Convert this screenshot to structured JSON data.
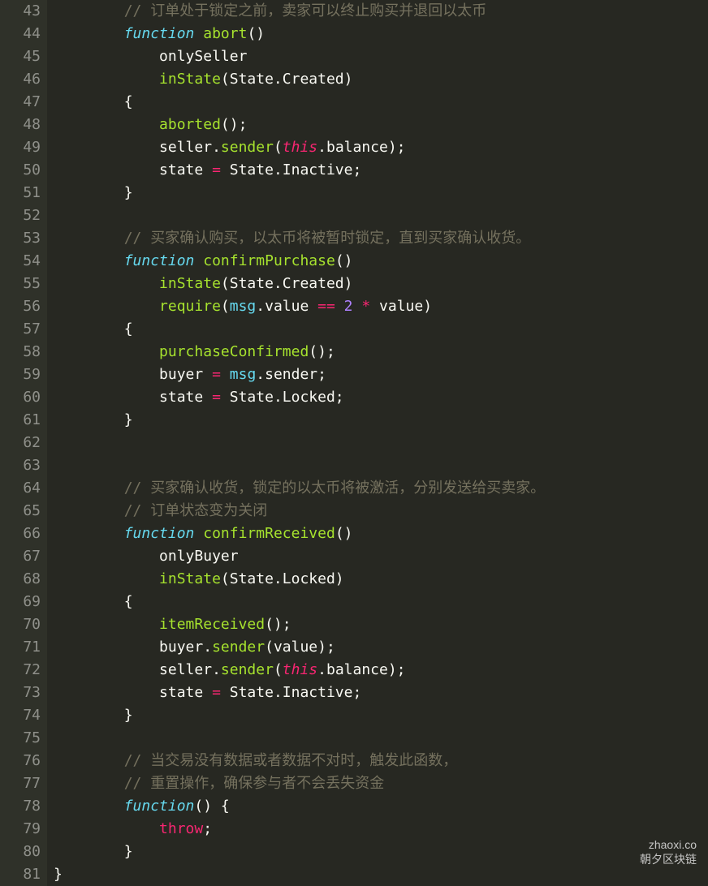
{
  "watermark": {
    "url": "zhaoxi.co",
    "text": "朝夕区块链"
  },
  "startLine": 43,
  "lines": [
    {
      "n": 43,
      "indent": 2,
      "t": [
        {
          "c": "tok-comment",
          "s": "// 订单处于锁定之前，卖家可以终止购买并退回以太币"
        }
      ]
    },
    {
      "n": 44,
      "indent": 2,
      "t": [
        {
          "c": "tok-keyword",
          "s": "function"
        },
        {
          "c": "tok-punct",
          "s": " "
        },
        {
          "c": "tok-funcname",
          "s": "abort"
        },
        {
          "c": "tok-punct",
          "s": "()"
        }
      ]
    },
    {
      "n": 45,
      "indent": 3,
      "t": [
        {
          "c": "tok-ident",
          "s": "onlySeller"
        }
      ]
    },
    {
      "n": 46,
      "indent": 3,
      "t": [
        {
          "c": "tok-funcname",
          "s": "inState"
        },
        {
          "c": "tok-punct",
          "s": "(State.Created)"
        }
      ]
    },
    {
      "n": 47,
      "indent": 2,
      "t": [
        {
          "c": "tok-punct",
          "s": "{"
        }
      ]
    },
    {
      "n": 48,
      "indent": 3,
      "t": [
        {
          "c": "tok-funcname",
          "s": "aborted"
        },
        {
          "c": "tok-punct",
          "s": "();"
        }
      ]
    },
    {
      "n": 49,
      "indent": 3,
      "t": [
        {
          "c": "tok-ident",
          "s": "seller."
        },
        {
          "c": "tok-funcname",
          "s": "sender"
        },
        {
          "c": "tok-punct",
          "s": "("
        },
        {
          "c": "tok-this",
          "s": "this"
        },
        {
          "c": "tok-punct",
          "s": ".balance);"
        }
      ]
    },
    {
      "n": 50,
      "indent": 3,
      "t": [
        {
          "c": "tok-ident",
          "s": "state "
        },
        {
          "c": "tok-op",
          "s": "="
        },
        {
          "c": "tok-ident",
          "s": " State.Inactive;"
        }
      ]
    },
    {
      "n": 51,
      "indent": 2,
      "t": [
        {
          "c": "tok-punct",
          "s": "}"
        }
      ]
    },
    {
      "n": 52,
      "indent": 0,
      "t": []
    },
    {
      "n": 53,
      "indent": 2,
      "t": [
        {
          "c": "tok-comment",
          "s": "// 买家确认购买，以太币将被暂时锁定，直到买家确认收货。"
        }
      ]
    },
    {
      "n": 54,
      "indent": 2,
      "t": [
        {
          "c": "tok-keyword",
          "s": "function"
        },
        {
          "c": "tok-punct",
          "s": " "
        },
        {
          "c": "tok-funcname",
          "s": "confirmPurchase"
        },
        {
          "c": "tok-punct",
          "s": "()"
        }
      ]
    },
    {
      "n": 55,
      "indent": 3,
      "t": [
        {
          "c": "tok-funcname",
          "s": "inState"
        },
        {
          "c": "tok-punct",
          "s": "(State.Created)"
        }
      ]
    },
    {
      "n": 56,
      "indent": 3,
      "t": [
        {
          "c": "tok-funcname",
          "s": "require"
        },
        {
          "c": "tok-punct",
          "s": "("
        },
        {
          "c": "tok-var",
          "s": "msg"
        },
        {
          "c": "tok-punct",
          "s": ".value "
        },
        {
          "c": "tok-op",
          "s": "=="
        },
        {
          "c": "tok-punct",
          "s": " "
        },
        {
          "c": "tok-number",
          "s": "2"
        },
        {
          "c": "tok-punct",
          "s": " "
        },
        {
          "c": "tok-op",
          "s": "*"
        },
        {
          "c": "tok-punct",
          "s": " value)"
        }
      ]
    },
    {
      "n": 57,
      "indent": 2,
      "t": [
        {
          "c": "tok-punct",
          "s": "{"
        }
      ]
    },
    {
      "n": 58,
      "indent": 3,
      "t": [
        {
          "c": "tok-funcname",
          "s": "purchaseConfirmed"
        },
        {
          "c": "tok-punct",
          "s": "();"
        }
      ]
    },
    {
      "n": 59,
      "indent": 3,
      "t": [
        {
          "c": "tok-ident",
          "s": "buyer "
        },
        {
          "c": "tok-op",
          "s": "="
        },
        {
          "c": "tok-ident",
          "s": " "
        },
        {
          "c": "tok-var",
          "s": "msg"
        },
        {
          "c": "tok-punct",
          "s": ".sender;"
        }
      ]
    },
    {
      "n": 60,
      "indent": 3,
      "t": [
        {
          "c": "tok-ident",
          "s": "state "
        },
        {
          "c": "tok-op",
          "s": "="
        },
        {
          "c": "tok-ident",
          "s": " State.Locked;"
        }
      ]
    },
    {
      "n": 61,
      "indent": 2,
      "t": [
        {
          "c": "tok-punct",
          "s": "}"
        }
      ]
    },
    {
      "n": 62,
      "indent": 0,
      "t": []
    },
    {
      "n": 63,
      "indent": 0,
      "t": []
    },
    {
      "n": 64,
      "indent": 2,
      "t": [
        {
          "c": "tok-comment",
          "s": "// 买家确认收货，锁定的以太币将被激活，分别发送给买卖家。"
        }
      ]
    },
    {
      "n": 65,
      "indent": 2,
      "t": [
        {
          "c": "tok-comment",
          "s": "// 订单状态变为关闭"
        }
      ]
    },
    {
      "n": 66,
      "indent": 2,
      "t": [
        {
          "c": "tok-keyword",
          "s": "function"
        },
        {
          "c": "tok-punct",
          "s": " "
        },
        {
          "c": "tok-funcname",
          "s": "confirmReceived"
        },
        {
          "c": "tok-punct",
          "s": "()"
        }
      ]
    },
    {
      "n": 67,
      "indent": 3,
      "t": [
        {
          "c": "tok-ident",
          "s": "onlyBuyer"
        }
      ]
    },
    {
      "n": 68,
      "indent": 3,
      "t": [
        {
          "c": "tok-funcname",
          "s": "inState"
        },
        {
          "c": "tok-punct",
          "s": "(State.Locked)"
        }
      ]
    },
    {
      "n": 69,
      "indent": 2,
      "t": [
        {
          "c": "tok-punct",
          "s": "{"
        }
      ]
    },
    {
      "n": 70,
      "indent": 3,
      "t": [
        {
          "c": "tok-funcname",
          "s": "itemReceived"
        },
        {
          "c": "tok-punct",
          "s": "();"
        }
      ]
    },
    {
      "n": 71,
      "indent": 3,
      "t": [
        {
          "c": "tok-ident",
          "s": "buyer."
        },
        {
          "c": "tok-funcname",
          "s": "sender"
        },
        {
          "c": "tok-punct",
          "s": "(value);"
        }
      ]
    },
    {
      "n": 72,
      "indent": 3,
      "t": [
        {
          "c": "tok-ident",
          "s": "seller."
        },
        {
          "c": "tok-funcname",
          "s": "sender"
        },
        {
          "c": "tok-punct",
          "s": "("
        },
        {
          "c": "tok-this",
          "s": "this"
        },
        {
          "c": "tok-punct",
          "s": ".balance);"
        }
      ]
    },
    {
      "n": 73,
      "indent": 3,
      "t": [
        {
          "c": "tok-ident",
          "s": "state "
        },
        {
          "c": "tok-op",
          "s": "="
        },
        {
          "c": "tok-ident",
          "s": " State.Inactive;"
        }
      ]
    },
    {
      "n": 74,
      "indent": 2,
      "t": [
        {
          "c": "tok-punct",
          "s": "}"
        }
      ]
    },
    {
      "n": 75,
      "indent": 0,
      "t": []
    },
    {
      "n": 76,
      "indent": 2,
      "t": [
        {
          "c": "tok-comment",
          "s": "// 当交易没有数据或者数据不对时，触发此函数，"
        }
      ]
    },
    {
      "n": 77,
      "indent": 2,
      "t": [
        {
          "c": "tok-comment",
          "s": "// 重置操作，确保参与者不会丢失资金"
        }
      ]
    },
    {
      "n": 78,
      "indent": 2,
      "t": [
        {
          "c": "tok-keyword",
          "s": "function"
        },
        {
          "c": "tok-punct",
          "s": "() {"
        }
      ]
    },
    {
      "n": 79,
      "indent": 3,
      "t": [
        {
          "c": "tok-throw",
          "s": "throw"
        },
        {
          "c": "tok-punct",
          "s": ";"
        }
      ]
    },
    {
      "n": 80,
      "indent": 2,
      "t": [
        {
          "c": "tok-punct",
          "s": "}"
        }
      ]
    },
    {
      "n": 81,
      "indent": 0,
      "t": [
        {
          "c": "tok-punct",
          "s": "}"
        }
      ]
    }
  ]
}
